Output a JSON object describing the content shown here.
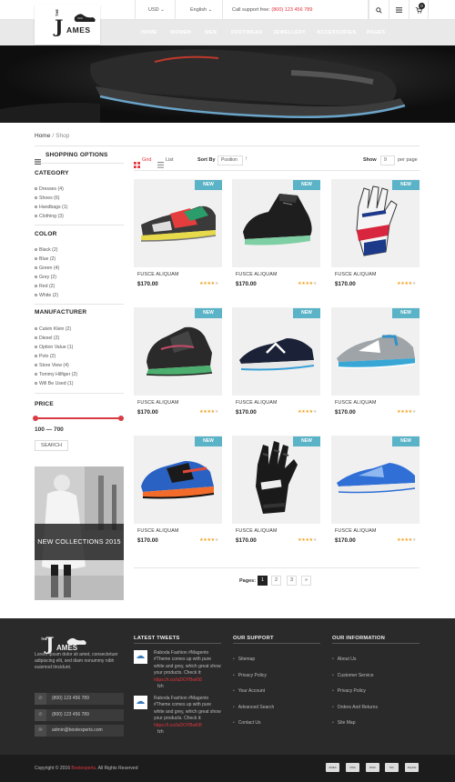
{
  "topbar": {
    "currency": "USD",
    "language": "English",
    "support_label": "Call support free: ",
    "support_phone": "(800) 123 456 789",
    "cart_count": "0"
  },
  "logo": {
    "the": "THE",
    "j": "J",
    "rest": "AMES"
  },
  "nav": [
    "HOME",
    "WOMEN",
    "MEN",
    "FOOTWEAR",
    "JEWELLERY",
    "ACCESSORIES",
    "PAGES"
  ],
  "breadcrumb": {
    "home": "Home",
    "sep": "/",
    "current": "Shop"
  },
  "sidebar": {
    "title": "SHOPPING OPTIONS",
    "category": {
      "head": "CATEGORY",
      "items": [
        "Dresses (4)",
        "Shoes (6)",
        "Handbags (1)",
        "Clothing (3)"
      ]
    },
    "color": {
      "head": "COLOR",
      "items": [
        "Black (2)",
        "Blue (2)",
        "Green (4)",
        "Grey (2)",
        "Red (2)",
        "White (2)"
      ]
    },
    "manufacturer": {
      "head": "MANUFACTURER",
      "items": [
        "Calvin Klein (2)",
        "Diesel (2)",
        "Option Value (1)",
        "Polo (2)",
        "Store View (4)",
        "Tommy Hilfiger (2)",
        "Will Be Used (1)"
      ]
    },
    "price": {
      "head": "PRICE",
      "range": "100 — 700",
      "button": "SEARCH",
      "min": 100,
      "max": 700
    },
    "banner_caption": "NEW COLLECTIONS 2015"
  },
  "toolbar": {
    "grid_label": "Grid",
    "list_label": "List",
    "sort_label": "Sort By",
    "sort_value": "Position",
    "show_label": "Show",
    "show_value": "9",
    "per_page": "per page"
  },
  "products": [
    {
      "badge": "NEW",
      "name": "FUSCE ALIQUAM",
      "price": "$170.00",
      "rating": 4
    },
    {
      "badge": "NEW",
      "name": "FUSCE ALIQUAM",
      "price": "$170.00",
      "rating": 4
    },
    {
      "badge": "NEW",
      "name": "FUSCE ALIQUAM",
      "price": "$170.00",
      "rating": 4
    },
    {
      "badge": "NEW",
      "name": "FUSCE ALIQUAM",
      "price": "$170.00",
      "rating": 4
    },
    {
      "badge": "NEW",
      "name": "FUSCE ALIQUAM",
      "price": "$170.00",
      "rating": 4
    },
    {
      "badge": "NEW",
      "name": "FUSCE ALIQUAM",
      "price": "$170.00",
      "rating": 4
    },
    {
      "badge": "NEW",
      "name": "FUSCE ALIQUAM",
      "price": "$170.00",
      "rating": 4
    },
    {
      "badge": "NEW",
      "name": "FUSCE ALIQUAM",
      "price": "$170.00",
      "rating": 4
    },
    {
      "badge": "NEW",
      "name": "FUSCE ALIQUAM",
      "price": "$170.00",
      "rating": 4
    }
  ],
  "pagination": {
    "label": "Pages:",
    "pages": [
      "1",
      "2",
      "3"
    ],
    "next": "»",
    "current": "1"
  },
  "footer": {
    "about": "Lorem ipsum dolor sit amet, consectetuer adipiscing elit, sed diam nonummy nibh euismod tincidunt.",
    "phone1": "(800) 123 456 789",
    "phone2": "(800) 123 456 789",
    "email": "admin@bootexperts.com",
    "tweets_head": "LATEST TWEETS",
    "tweets": [
      {
        "text": "Raboda Fashion #Magento #Theme comes up with pure white and grey, which great show your products. Check it: ",
        "link": "https://t.co/luDOYBwl08",
        "meta": "fzh"
      },
      {
        "text": "Raboda Fashion #Magento #Theme comes up with pure white and grey, which great show your products. Check it: ",
        "link": "https://t.co/luDOYBwl08",
        "meta": "fzh"
      }
    ],
    "support_head": "OUR SUPPORT",
    "support_links": [
      "Sitemap",
      "Privacy Policy",
      "Your Account",
      "Advanced Search",
      "Contact Us"
    ],
    "info_head": "OUR INFORMATION",
    "info_links": [
      "About Us",
      "Customer Service",
      "Privacy Policy",
      "Orders And Returns",
      "Site Map"
    ],
    "copyright_pre": "Copyright © 2016 ",
    "copyright_brand": "Bootexperts",
    "copyright_post": ". All Rights Reserved",
    "payments": [
      "AMEX",
      "VISA",
      "DISC",
      "MC",
      "PayPal"
    ]
  },
  "colors": {
    "accent": "#e0343d",
    "badge": "#5ab3c6",
    "footer": "#2a2a2a",
    "star": "#f0a01e"
  }
}
